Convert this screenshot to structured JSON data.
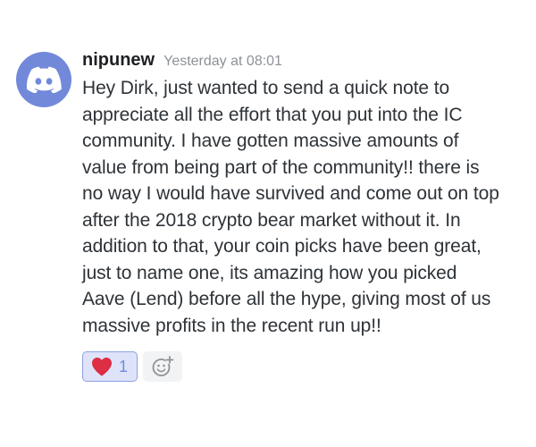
{
  "message": {
    "author": "nipunew",
    "timestamp": "Yesterday at 08:01",
    "lines": [
      "Hey Dirk, just wanted to send a quick note to",
      "appreciate all the effort that you put into the IC",
      "community. I have gotten massive amounts of",
      "value from being part of the community!! there is",
      "no way I would have survived and come out on top",
      "after the 2018 crypto bear market without it. In",
      "addition to that, your coin picks have been great,",
      "just to name one, its amazing how you picked",
      "Aave (Lend) before all the hype, giving most of us",
      "massive profits in the recent run up!!"
    ]
  },
  "reactions": [
    {
      "emoji": "heart-icon",
      "count": "1"
    }
  ],
  "colors": {
    "avatar_bg": "#7289da",
    "reaction_bg": "#dfe3fa",
    "reaction_border": "#8ea1e1",
    "reaction_count": "#7289da",
    "heart": "#dd2e44",
    "timestamp": "#8e9297"
  }
}
